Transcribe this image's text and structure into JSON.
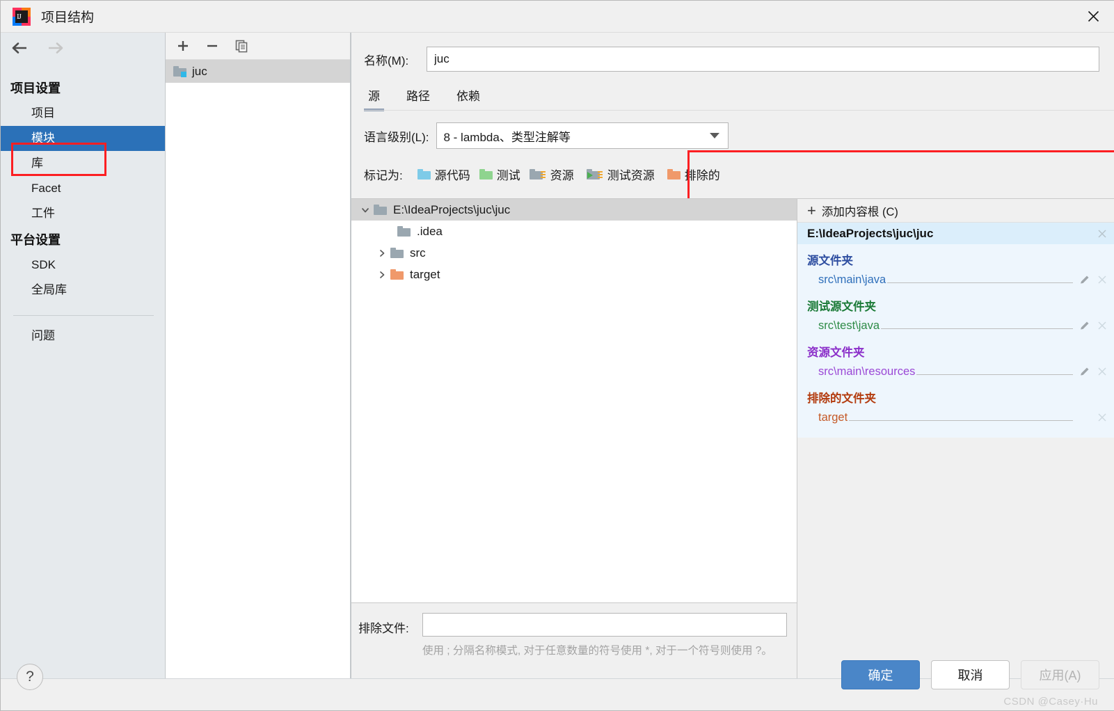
{
  "window": {
    "title": "项目结构",
    "app_icon": "intellij-idea-icon",
    "close_icon": "close-icon"
  },
  "sidebar": {
    "back_icon": "back-arrow-icon",
    "forward_icon": "forward-arrow-icon",
    "groups": [
      {
        "title": "项目设置",
        "items": [
          {
            "label": "项目",
            "selected": false
          },
          {
            "label": "模块",
            "selected": true
          },
          {
            "label": "库",
            "selected": false
          },
          {
            "label": "Facet",
            "selected": false
          },
          {
            "label": "工件",
            "selected": false
          }
        ]
      },
      {
        "title": "平台设置",
        "items": [
          {
            "label": "SDK",
            "selected": false
          },
          {
            "label": "全局库",
            "selected": false
          }
        ]
      }
    ],
    "problems_label": "问题"
  },
  "module_list": {
    "toolbar": {
      "add_icon": "plus-icon",
      "remove_icon": "minus-icon",
      "copy_icon": "copy-icon"
    },
    "modules": [
      {
        "name": "juc",
        "selected": true,
        "icon": "module-folder-icon"
      }
    ]
  },
  "main": {
    "name_label": "名称(M):",
    "name_value": "juc",
    "name_placeholder": "",
    "tabs": [
      {
        "label": "源",
        "active": true
      },
      {
        "label": "路径",
        "active": false
      },
      {
        "label": "依赖",
        "active": false
      }
    ],
    "language_level": {
      "label": "语言级别(L):",
      "value": "8 - lambda、类型注解等",
      "caret_icon": "chevron-down-icon"
    },
    "mark_as": {
      "label": "标记为:",
      "options": [
        {
          "label": "源代码",
          "color": "#7ecbe8",
          "icon": "sources-folder-icon"
        },
        {
          "label": "测试",
          "color": "#8fd48f",
          "icon": "tests-folder-icon"
        },
        {
          "label": "资源",
          "color": "#9aa7b0",
          "icon": "resources-folder-icon"
        },
        {
          "label": "测试资源",
          "color": "#9aa7b0",
          "icon": "test-resources-folder-icon"
        },
        {
          "label": "排除的",
          "color": "#f0996a",
          "icon": "excluded-folder-icon"
        }
      ]
    },
    "tree": [
      {
        "label": "E:\\IdeaProjects\\juc\\juc",
        "depth": 0,
        "chevron": "expanded",
        "color": "#9aa7b0",
        "selected": true
      },
      {
        "label": ".idea",
        "depth": 1,
        "chevron": "none",
        "color": "#9aa7b0",
        "selected": false
      },
      {
        "label": "src",
        "depth": 1,
        "chevron": "collapsed",
        "color": "#9aa7b0",
        "selected": false
      },
      {
        "label": "target",
        "depth": 1,
        "chevron": "collapsed",
        "color": "#f0996a",
        "selected": false
      }
    ],
    "exclude": {
      "label": "排除文件:",
      "value": "",
      "placeholder": "",
      "hint": "使用 ; 分隔名称模式, 对于任意数量的符号使用 *, 对于一个符号则使用 ?。"
    }
  },
  "content_roots": {
    "add_label": "添加内容根 (C)",
    "add_mnemonic": "C",
    "add_icon": "plus-icon",
    "root_path": "E:\\IdeaProjects\\juc\\juc",
    "root_close_icon": "close-small-icon",
    "groups": [
      {
        "title": "源文件夹",
        "color": "#2d4da0",
        "paths": [
          {
            "path": "src\\main\\java",
            "color": "#2f6fba",
            "edit_icon": "pencil-icon",
            "close_icon": "close-small-icon"
          }
        ]
      },
      {
        "title": "测试源文件夹",
        "color": "#1a7a36",
        "paths": [
          {
            "path": "src\\test\\java",
            "color": "#2e8b46",
            "edit_icon": "pencil-icon",
            "close_icon": "close-small-icon"
          }
        ]
      },
      {
        "title": "资源文件夹",
        "color": "#8b2fc9",
        "paths": [
          {
            "path": "src\\main\\resources",
            "color": "#9b48d6",
            "edit_icon": "pencil-icon",
            "close_icon": "close-small-icon"
          }
        ]
      },
      {
        "title": "排除的文件夹",
        "color": "#b33b0e",
        "paths": [
          {
            "path": "target",
            "color": "#c55a28",
            "edit_icon": "",
            "close_icon": "close-small-icon"
          }
        ]
      }
    ]
  },
  "footer": {
    "help_label": "?",
    "help_icon": "help-icon",
    "ok_label": "确定",
    "cancel_label": "取消",
    "apply_label": "应用(A)",
    "watermark": "CSDN @Casey·Hu"
  },
  "highlights": {
    "accent_red": "#fc1f22",
    "selection_blue": "#2b71b8"
  }
}
